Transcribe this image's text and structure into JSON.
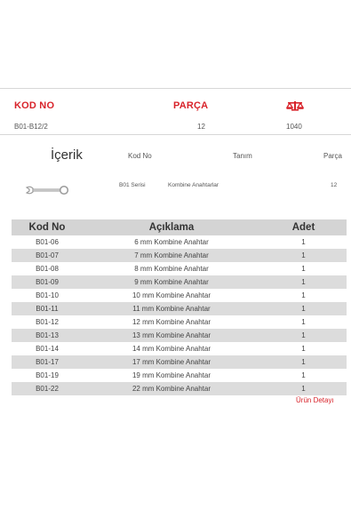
{
  "header": {
    "kod_no_label": "KOD NO",
    "parca_label": "PARÇA",
    "weight_icon": "scale-icon",
    "kod_no_value": "B01-B12/2",
    "parca_value": "12",
    "weight_value": "1040"
  },
  "contents": {
    "title": "İçerik",
    "col_kod_no": "Kod No",
    "col_tanim": "Tanım",
    "col_parca": "Parça",
    "row": {
      "icon": "combination-wrench-icon",
      "kod_no": "B01 Serisi",
      "tanim": "Kombine Anahtarlar",
      "parca": "12"
    }
  },
  "items_table": {
    "headers": [
      "Kod No",
      "Açıklama",
      "Adet"
    ],
    "rows": [
      [
        "B01-06",
        "6 mm Kombine Anahtar",
        "1"
      ],
      [
        "B01-07",
        "7 mm Kombine Anahtar",
        "1"
      ],
      [
        "B01-08",
        "8 mm Kombine Anahtar",
        "1"
      ],
      [
        "B01-09",
        "9 mm Kombine Anahtar",
        "1"
      ],
      [
        "B01-10",
        "10 mm Kombine Anahtar",
        "1"
      ],
      [
        "B01-11",
        "11 mm Kombine Anahtar",
        "1"
      ],
      [
        "B01-12",
        "12 mm Kombine Anahtar",
        "1"
      ],
      [
        "B01-13",
        "13 mm Kombine Anahtar",
        "1"
      ],
      [
        "B01-14",
        "14 mm Kombine Anahtar",
        "1"
      ],
      [
        "B01-17",
        "17 mm Kombine Anahtar",
        "1"
      ],
      [
        "B01-19",
        "19 mm Kombine Anahtar",
        "1"
      ],
      [
        "B01-22",
        "22 mm Kombine Anahtar",
        "1"
      ]
    ]
  },
  "product_detail_link": "Ürün Detayı",
  "colors": {
    "accent": "#d8232a",
    "row_shade": "#dcdcdc",
    "header_shade": "#d4d4d4"
  }
}
